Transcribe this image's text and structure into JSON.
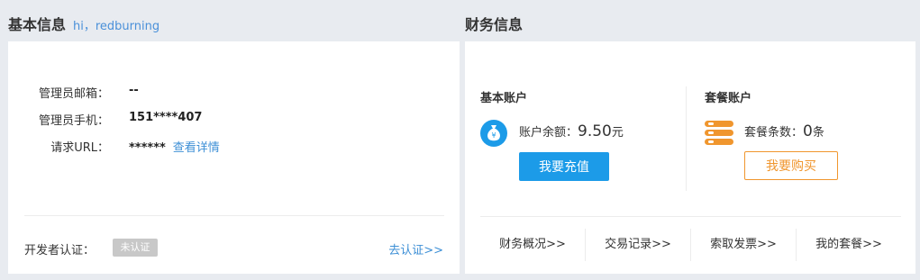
{
  "basic": {
    "title": "基本信息",
    "greeting": "hi，redburning",
    "rows": [
      {
        "label": "管理员邮箱：",
        "value": "--"
      },
      {
        "label": "管理员手机：",
        "value": "151****407"
      },
      {
        "label": "请求URL：",
        "value": "******",
        "link": "查看详情"
      }
    ],
    "dev_label": "开发者认证：",
    "dev_status": "未认证",
    "go_auth": "去认证>>"
  },
  "finance": {
    "title": "财务信息",
    "basic_account": {
      "title": "基本账户",
      "balance_label": "账户余额：",
      "balance_value": "9.50",
      "balance_unit": "元",
      "button": "我要充值",
      "icon": "money-bag-icon"
    },
    "package_account": {
      "title": "套餐账户",
      "count_label": "套餐条数：",
      "count_value": "0",
      "count_unit": "条",
      "button": "我要购买",
      "icon": "package-stack-icon"
    },
    "links": [
      "财务概况>>",
      "交易记录>>",
      "索取发票>>",
      "我的套餐>>"
    ]
  },
  "colors": {
    "accent_blue": "#1c9be8",
    "link_blue": "#3d8fd6",
    "accent_orange": "#f0962e",
    "page_bg": "#e8ebf0"
  }
}
